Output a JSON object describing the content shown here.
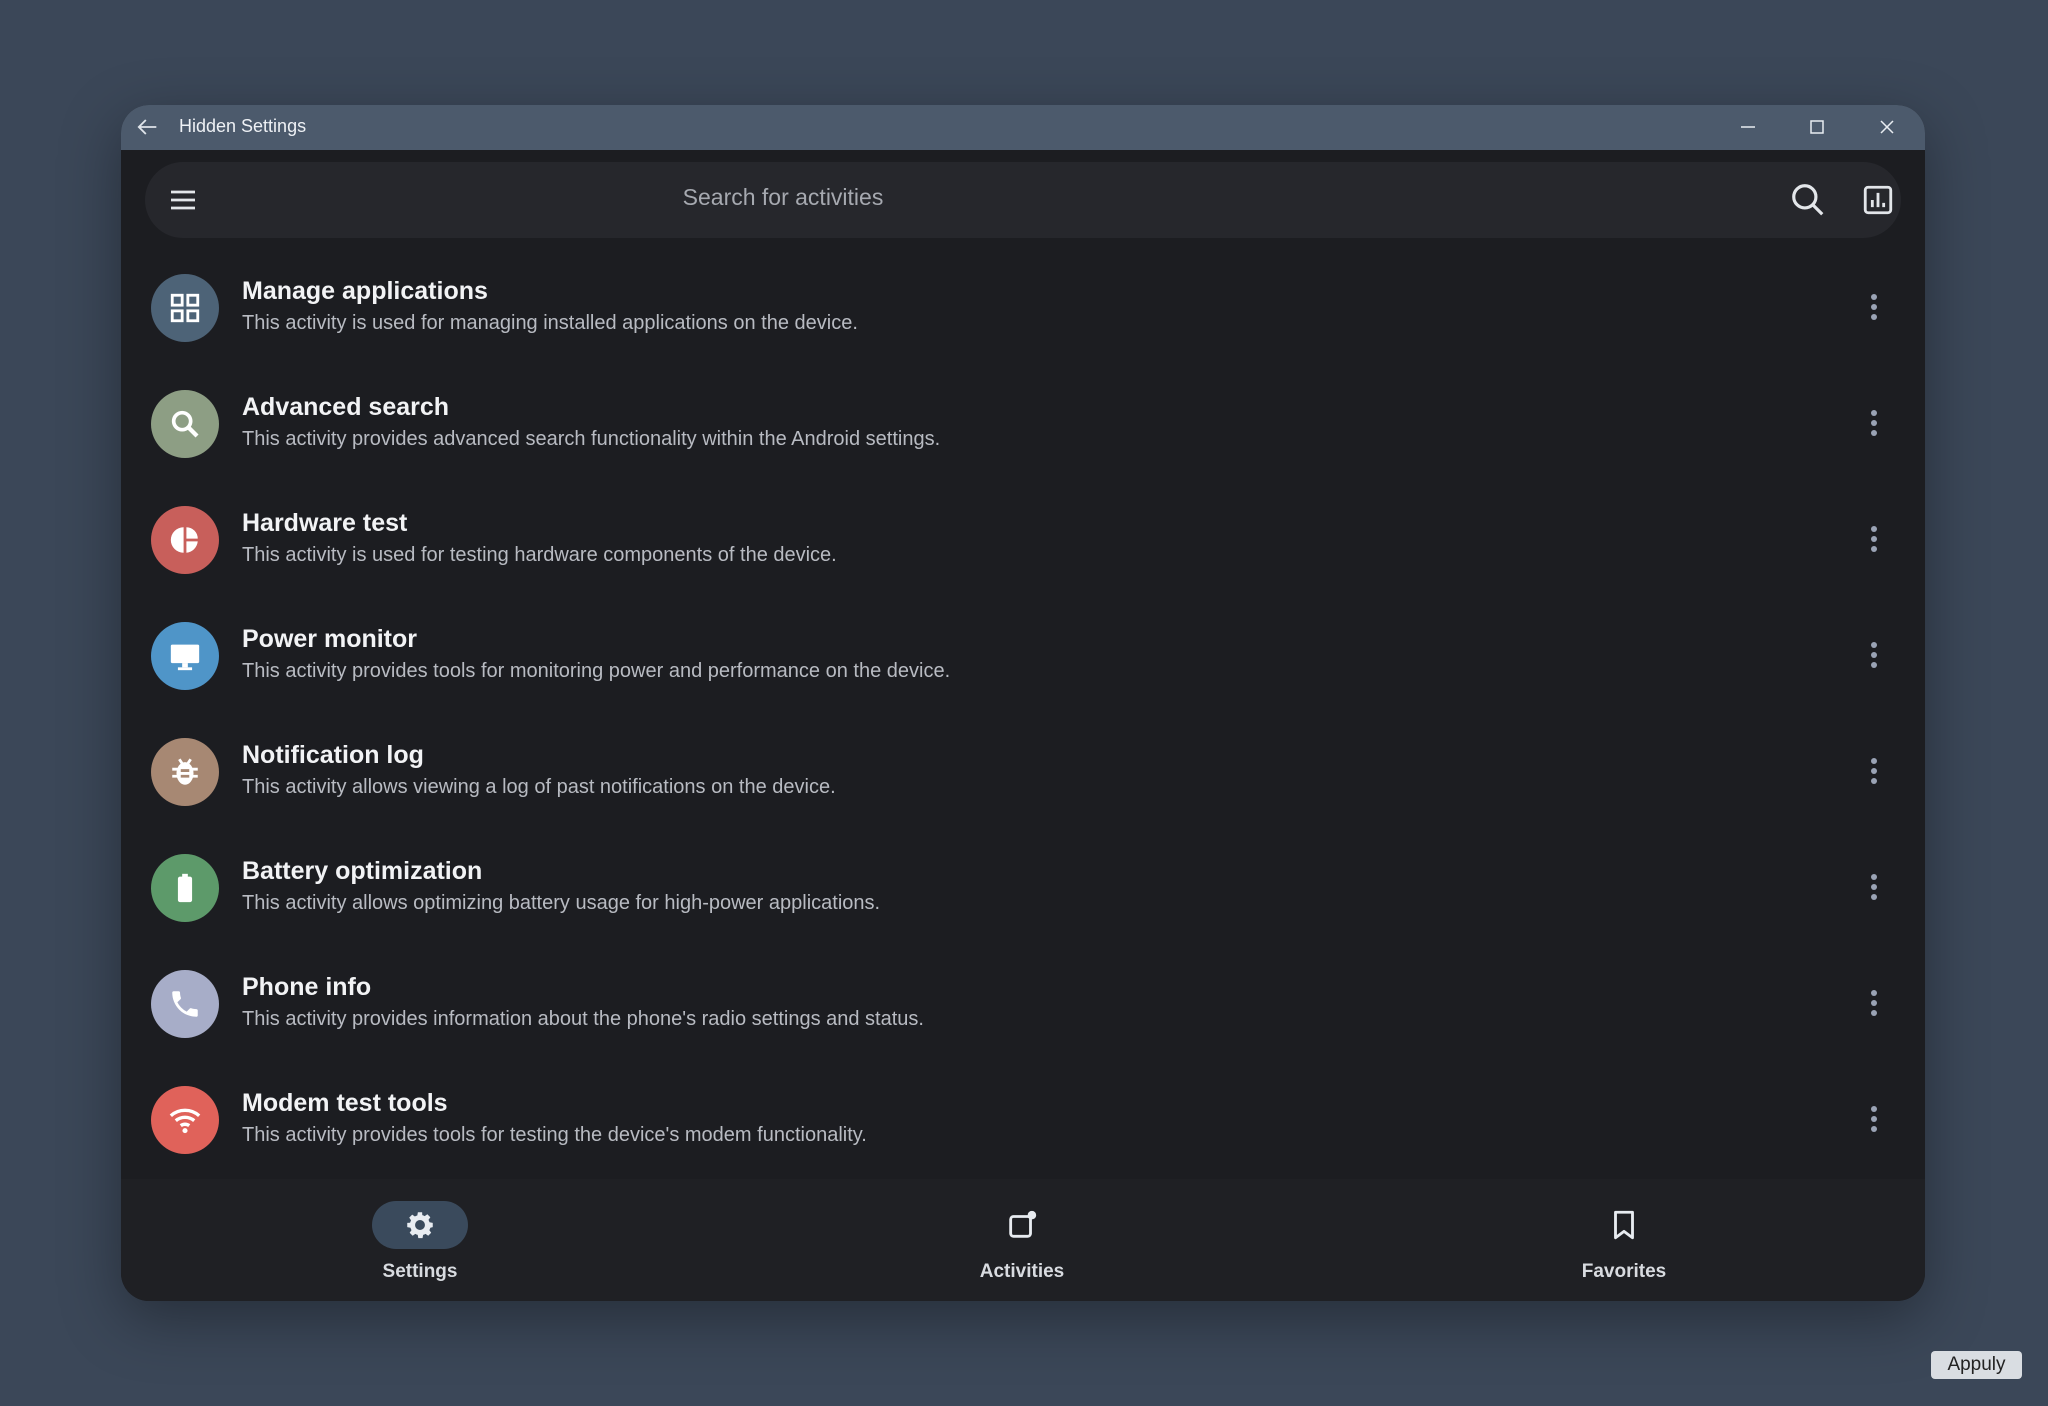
{
  "window": {
    "title": "Hidden Settings"
  },
  "search": {
    "placeholder": "Search for activities"
  },
  "activities": [
    {
      "title": "Manage applications",
      "desc": "This activity is used for managing installed applications on the device.",
      "icon": "grid-icon",
      "color": "#4d6377"
    },
    {
      "title": "Advanced search",
      "desc": "This activity provides advanced search functionality within the Android settings.",
      "icon": "search-icon",
      "color": "#8d9e84"
    },
    {
      "title": "Hardware test",
      "desc": "This activity is used for testing hardware components of the device.",
      "icon": "pie-chart-icon",
      "color": "#c85f5b"
    },
    {
      "title": "Power monitor",
      "desc": "This activity provides tools for monitoring power and performance on the device.",
      "icon": "monitor-icon",
      "color": "#4f95c8"
    },
    {
      "title": "Notification log",
      "desc": "This activity allows viewing a log of past notifications on the device.",
      "icon": "bug-icon",
      "color": "#a78873"
    },
    {
      "title": "Battery optimization",
      "desc": "This activity allows optimizing battery usage for high-power applications.",
      "icon": "battery-icon",
      "color": "#5d9a6a"
    },
    {
      "title": "Phone info",
      "desc": "This activity provides information about the phone's radio settings and status.",
      "icon": "phone-icon",
      "color": "#a7adc8"
    },
    {
      "title": "Modem test tools",
      "desc": "This activity provides tools for testing the device's modem functionality.",
      "icon": "wifi-icon",
      "color": "#e0625a"
    }
  ],
  "nav": [
    {
      "label": "Settings",
      "icon": "gear-icon",
      "active": true
    },
    {
      "label": "Activities",
      "icon": "activities-icon",
      "active": false
    },
    {
      "label": "Favorites",
      "icon": "bookmark-icon",
      "active": false
    }
  ],
  "watermark": "Appuly"
}
